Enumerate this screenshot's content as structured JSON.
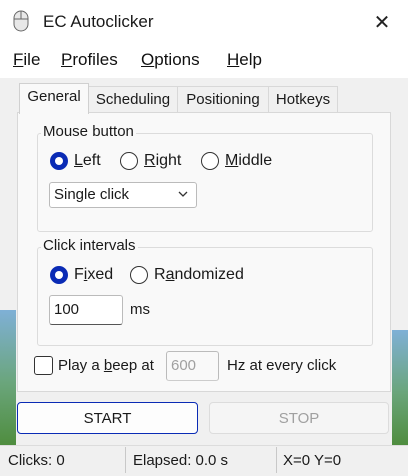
{
  "window": {
    "title": "EC Autoclicker",
    "close_glyph": "✕"
  },
  "menu": [
    {
      "underline": "F",
      "rest": "ile"
    },
    {
      "underline": "P",
      "rest": "rofiles"
    },
    {
      "underline": "O",
      "rest": "ptions"
    },
    {
      "underline": "H",
      "rest": "elp"
    }
  ],
  "tabs": [
    "General",
    "Scheduling",
    "Positioning",
    "Hotkeys"
  ],
  "active_tab": "General",
  "mouse_button": {
    "label": "Mouse button",
    "options": [
      {
        "u": "L",
        "rest": "eft",
        "selected": true
      },
      {
        "u": "R",
        "rest": "ight",
        "selected": false
      },
      {
        "u": "M",
        "rest": "iddle",
        "selected": false
      }
    ],
    "click_type": "Single click"
  },
  "click_intervals": {
    "label": "Click intervals",
    "fixed": {
      "pre": "F",
      "u": "i",
      "rest": "xed",
      "selected": true
    },
    "randomized": {
      "pre": "R",
      "u": "a",
      "rest": "ndomized",
      "selected": false
    },
    "value": "100",
    "unit": "ms"
  },
  "beep": {
    "pre": "Play a ",
    "u": "b",
    "rest": "eep at",
    "checked": false,
    "hz_placeholder": "600",
    "suffix": "Hz at every click"
  },
  "buttons": {
    "start": "START",
    "stop": "STOP"
  },
  "status": {
    "clicks": "Clicks: 0",
    "elapsed": "Elapsed: 0.0 s",
    "coords": "X=0 Y=0"
  },
  "colors": {
    "accent": "#0a2bb5",
    "disabled_text": "#a0a0a0"
  }
}
